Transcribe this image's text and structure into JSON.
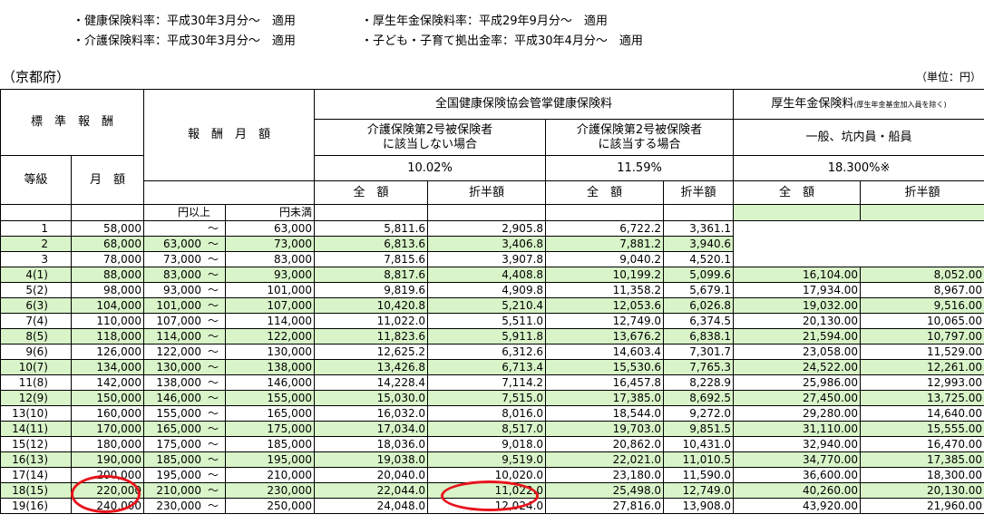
{
  "notes": {
    "line1_left": "・健康保険料率：平成30年3月分～　適用",
    "line1_right": "・厚生年金保険料率：平成29年9月分～　適用",
    "line2_left": "・介護保険料率：平成30年3月分～　適用",
    "line2_right": "・子ども・子育て拠出金率：平成30年4月分～　適用"
  },
  "prefecture": "（京都府）",
  "unit": "（単位：円）",
  "header": {
    "standard_remuneration": "標　準　報　酬",
    "grade": "等級",
    "monthly": "月　額",
    "monthly_remuneration": "報　酬　月　額",
    "kyokai": "全国健康保険協会管掌健康保険料",
    "kaigo_no_1": "介護保険第2号被保険者",
    "kaigo_no_2": "に該当しない場合",
    "kaigo_yes_1": "介護保険第2号被保険者",
    "kaigo_yes_2": "に該当する場合",
    "rate_no": "10.02%",
    "rate_yes": "11.59%",
    "emp_title": "厚生年金保険料",
    "emp_note": "(厚生年金基金加入員を除く)",
    "emp_sub": "一般、坑内員・船員",
    "emp_rate": "18.300%※",
    "full": "全　額",
    "half": "折半額",
    "min_label": "円以上",
    "max_label": "円未満"
  },
  "rows": [
    {
      "grade": "1",
      "monthly": "58,000",
      "min": "",
      "max": "63,000",
      "hf": "5,811.6",
      "hh": "2,905.8",
      "kf": "6,722.2",
      "kh": "3,361.1",
      "pf": "",
      "ph": ""
    },
    {
      "grade": "2",
      "monthly": "68,000",
      "min": "63,000",
      "max": "73,000",
      "hf": "6,813.6",
      "hh": "3,406.8",
      "kf": "7,881.2",
      "kh": "3,940.6",
      "pf": "",
      "ph": ""
    },
    {
      "grade": "3",
      "monthly": "78,000",
      "min": "73,000",
      "max": "83,000",
      "hf": "7,815.6",
      "hh": "3,907.8",
      "kf": "9,040.2",
      "kh": "4,520.1",
      "pf": "",
      "ph": ""
    },
    {
      "grade": "4(1)",
      "monthly": "88,000",
      "min": "83,000",
      "max": "93,000",
      "hf": "8,817.6",
      "hh": "4,408.8",
      "kf": "10,199.2",
      "kh": "5,099.6",
      "pf": "16,104.00",
      "ph": "8,052.00"
    },
    {
      "grade": "5(2)",
      "monthly": "98,000",
      "min": "93,000",
      "max": "101,000",
      "hf": "9,819.6",
      "hh": "4,909.8",
      "kf": "11,358.2",
      "kh": "5,679.1",
      "pf": "17,934.00",
      "ph": "8,967.00"
    },
    {
      "grade": "6(3)",
      "monthly": "104,000",
      "min": "101,000",
      "max": "107,000",
      "hf": "10,420.8",
      "hh": "5,210.4",
      "kf": "12,053.6",
      "kh": "6,026.8",
      "pf": "19,032.00",
      "ph": "9,516.00"
    },
    {
      "grade": "7(4)",
      "monthly": "110,000",
      "min": "107,000",
      "max": "114,000",
      "hf": "11,022.0",
      "hh": "5,511.0",
      "kf": "12,749.0",
      "kh": "6,374.5",
      "pf": "20,130.00",
      "ph": "10,065.00"
    },
    {
      "grade": "8(5)",
      "monthly": "118,000",
      "min": "114,000",
      "max": "122,000",
      "hf": "11,823.6",
      "hh": "5,911.8",
      "kf": "13,676.2",
      "kh": "6,838.1",
      "pf": "21,594.00",
      "ph": "10,797.00"
    },
    {
      "grade": "9(6)",
      "monthly": "126,000",
      "min": "122,000",
      "max": "130,000",
      "hf": "12,625.2",
      "hh": "6,312.6",
      "kf": "14,603.4",
      "kh": "7,301.7",
      "pf": "23,058.00",
      "ph": "11,529.00"
    },
    {
      "grade": "10(7)",
      "monthly": "134,000",
      "min": "130,000",
      "max": "138,000",
      "hf": "13,426.8",
      "hh": "6,713.4",
      "kf": "15,530.6",
      "kh": "7,765.3",
      "pf": "24,522.00",
      "ph": "12,261.00"
    },
    {
      "grade": "11(8)",
      "monthly": "142,000",
      "min": "138,000",
      "max": "146,000",
      "hf": "14,228.4",
      "hh": "7,114.2",
      "kf": "16,457.8",
      "kh": "8,228.9",
      "pf": "25,986.00",
      "ph": "12,993.00"
    },
    {
      "grade": "12(9)",
      "monthly": "150,000",
      "min": "146,000",
      "max": "155,000",
      "hf": "15,030.0",
      "hh": "7,515.0",
      "kf": "17,385.0",
      "kh": "8,692.5",
      "pf": "27,450.00",
      "ph": "13,725.00"
    },
    {
      "grade": "13(10)",
      "monthly": "160,000",
      "min": "155,000",
      "max": "165,000",
      "hf": "16,032.0",
      "hh": "8,016.0",
      "kf": "18,544.0",
      "kh": "9,272.0",
      "pf": "29,280.00",
      "ph": "14,640.00"
    },
    {
      "grade": "14(11)",
      "monthly": "170,000",
      "min": "165,000",
      "max": "175,000",
      "hf": "17,034.0",
      "hh": "8,517.0",
      "kf": "19,703.0",
      "kh": "9,851.5",
      "pf": "31,110.00",
      "ph": "15,555.00"
    },
    {
      "grade": "15(12)",
      "monthly": "180,000",
      "min": "175,000",
      "max": "185,000",
      "hf": "18,036.0",
      "hh": "9,018.0",
      "kf": "20,862.0",
      "kh": "10,431.0",
      "pf": "32,940.00",
      "ph": "16,470.00"
    },
    {
      "grade": "16(13)",
      "monthly": "190,000",
      "min": "185,000",
      "max": "195,000",
      "hf": "19,038.0",
      "hh": "9,519.0",
      "kf": "22,021.0",
      "kh": "11,010.5",
      "pf": "34,770.00",
      "ph": "17,385.00"
    },
    {
      "grade": "17(14)",
      "monthly": "200,000",
      "min": "195,000",
      "max": "210,000",
      "hf": "20,040.0",
      "hh": "10,020.0",
      "kf": "23,180.0",
      "kh": "11,590.0",
      "pf": "36,600.00",
      "ph": "18,300.00"
    },
    {
      "grade": "18(15)",
      "monthly": "220,000",
      "min": "210,000",
      "max": "230,000",
      "hf": "22,044.0",
      "hh": "11,022.0",
      "kf": "25,498.0",
      "kh": "12,749.0",
      "pf": "40,260.00",
      "ph": "20,130.00"
    },
    {
      "grade": "19(16)",
      "monthly": "240,000",
      "min": "230,000",
      "max": "250,000",
      "hf": "24,048.0",
      "hh": "12,024.0",
      "kf": "27,816.0",
      "kh": "13,908.0",
      "pf": "43,920.00",
      "ph": "21,960.00"
    }
  ],
  "tilde": "～",
  "colors": {
    "green_row": "#d8f4c8",
    "annotation_circle": "#e8141c"
  }
}
